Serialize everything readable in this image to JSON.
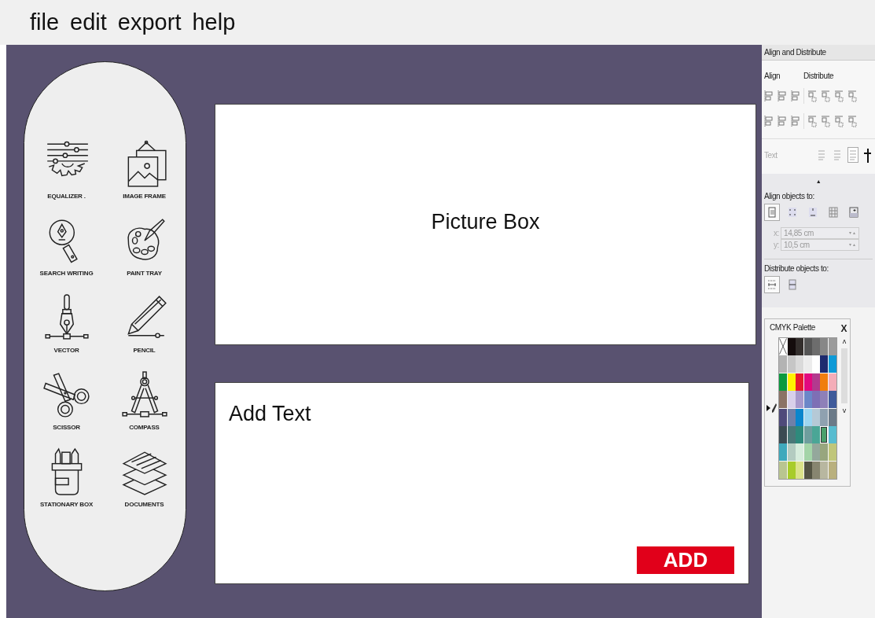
{
  "menu": [
    "file",
    "edit",
    "export",
    "help"
  ],
  "tools": [
    {
      "label": "EQUALIZER ."
    },
    {
      "label": "IMAGE FRAME"
    },
    {
      "label": "SEARCH WRITING"
    },
    {
      "label": "PAINT TRAY"
    },
    {
      "label": "VECTOR"
    },
    {
      "label": "PENCIL"
    },
    {
      "label": "SCISSOR"
    },
    {
      "label": "COMPASS"
    },
    {
      "label": "STATIONARY BOX"
    },
    {
      "label": "DOCUMENTS"
    }
  ],
  "picture_box": {
    "label": "Picture Box"
  },
  "text_box": {
    "text": "Add Text",
    "button": "ADD"
  },
  "align_panel": {
    "title": "Align and Distribute",
    "align_label": "Align",
    "distribute_label": "Distribute",
    "text_label": "Text",
    "text_options": [
      {
        "selected": false
      },
      {
        "selected": false
      },
      {
        "selected": true
      }
    ],
    "collapse": "▲",
    "align_objects_label": "Align objects to:",
    "align_objects_options": [
      {
        "selected": true
      },
      {
        "selected": false
      },
      {
        "selected": false
      },
      {
        "selected": false
      },
      {
        "selected": false
      }
    ],
    "x_label": "x:",
    "x_value": "14,85 cm",
    "y_label": "y:",
    "y_value": "10,5 cm",
    "distribute_objects_label": "Distribute objects to:",
    "distribute_objects_options": [
      {
        "selected": true
      },
      {
        "selected": false
      }
    ]
  },
  "palette": {
    "title": "CMYK Palette",
    "close": "X",
    "scroll_up": "ʌ",
    "scroll_down": "v",
    "swatches": [
      {
        "kind": "none",
        "selected": false
      },
      {
        "kind": "color",
        "color": "#140c0c",
        "selected": false
      },
      {
        "kind": "color",
        "color": "#332e2c",
        "selected": false
      },
      {
        "kind": "color",
        "color": "#555555",
        "selected": false
      },
      {
        "kind": "color",
        "color": "#6d6d6d",
        "selected": false
      },
      {
        "kind": "color",
        "color": "#878787",
        "selected": false
      },
      {
        "kind": "color",
        "color": "#9b9b9b",
        "selected": false
      },
      {
        "kind": "color",
        "color": "#b3b3b3",
        "selected": false
      },
      {
        "kind": "color",
        "color": "#c6c6c6",
        "selected": false
      },
      {
        "kind": "color",
        "color": "#dadada",
        "selected": false
      },
      {
        "kind": "color",
        "color": "#ececec",
        "selected": false
      },
      {
        "kind": "color",
        "color": "#ffffff",
        "selected": false
      },
      {
        "kind": "color",
        "color": "#1d2a6e",
        "selected": false
      },
      {
        "kind": "color",
        "color": "#0e9ad7",
        "selected": false
      },
      {
        "kind": "color",
        "color": "#0a9a3e",
        "selected": false
      },
      {
        "kind": "color",
        "color": "#fff200",
        "selected": false
      },
      {
        "kind": "color",
        "color": "#e6192e",
        "selected": false
      },
      {
        "kind": "color",
        "color": "#e2097f",
        "selected": false
      },
      {
        "kind": "color",
        "color": "#b23a8e",
        "selected": false
      },
      {
        "kind": "color",
        "color": "#f07e0e",
        "selected": false
      },
      {
        "kind": "color",
        "color": "#f4adb8",
        "selected": false
      },
      {
        "kind": "color",
        "color": "#8b7366",
        "selected": false
      },
      {
        "kind": "color",
        "color": "#d8d0ea",
        "selected": false
      },
      {
        "kind": "color",
        "color": "#a799cc",
        "selected": false
      },
      {
        "kind": "color",
        "color": "#6b87c8",
        "selected": false
      },
      {
        "kind": "color",
        "color": "#7e6fb5",
        "selected": false
      },
      {
        "kind": "color",
        "color": "#8e80b8",
        "selected": false
      },
      {
        "kind": "color",
        "color": "#3e5a9a",
        "selected": false
      },
      {
        "kind": "color",
        "color": "#4f4a7a",
        "selected": false
      },
      {
        "kind": "color",
        "color": "#6f80a8",
        "selected": false
      },
      {
        "kind": "color",
        "color": "#0a86cc",
        "selected": false
      },
      {
        "kind": "color",
        "color": "#9ed6f0",
        "selected": false
      },
      {
        "kind": "color",
        "color": "#b5c9d6",
        "selected": false
      },
      {
        "kind": "color",
        "color": "#8fa1b0",
        "selected": false
      },
      {
        "kind": "color",
        "color": "#6b7a88",
        "selected": false
      },
      {
        "kind": "color",
        "color": "#3b4a52",
        "selected": false
      },
      {
        "kind": "color",
        "color": "#4a7878",
        "selected": false
      },
      {
        "kind": "color",
        "color": "#2e8a7c",
        "selected": false
      },
      {
        "kind": "color",
        "color": "#6e9e9e",
        "selected": false
      },
      {
        "kind": "color",
        "color": "#4aa696",
        "selected": false
      },
      {
        "kind": "color",
        "color": "#4aa06c",
        "selected": true
      },
      {
        "kind": "color",
        "color": "#58bcd0",
        "selected": false
      },
      {
        "kind": "color",
        "color": "#3fa9bc",
        "selected": false
      },
      {
        "kind": "color",
        "color": "#b3cbc0",
        "selected": false
      },
      {
        "kind": "color",
        "color": "#d6ecdc",
        "selected": false
      },
      {
        "kind": "color",
        "color": "#a3d4a8",
        "selected": false
      },
      {
        "kind": "color",
        "color": "#94a89c",
        "selected": false
      },
      {
        "kind": "color",
        "color": "#98a67e",
        "selected": false
      },
      {
        "kind": "color",
        "color": "#c0c67a",
        "selected": false
      },
      {
        "kind": "color",
        "color": "#b9c590",
        "selected": false
      },
      {
        "kind": "color",
        "color": "#a8cc2a",
        "selected": false
      },
      {
        "kind": "color",
        "color": "#dbe38a",
        "selected": false
      },
      {
        "kind": "color",
        "color": "#545444",
        "selected": false
      },
      {
        "kind": "color",
        "color": "#878570",
        "selected": false
      },
      {
        "kind": "color",
        "color": "#b8b7a0",
        "selected": false
      },
      {
        "kind": "color",
        "color": "#b9b07e",
        "selected": false
      }
    ]
  }
}
